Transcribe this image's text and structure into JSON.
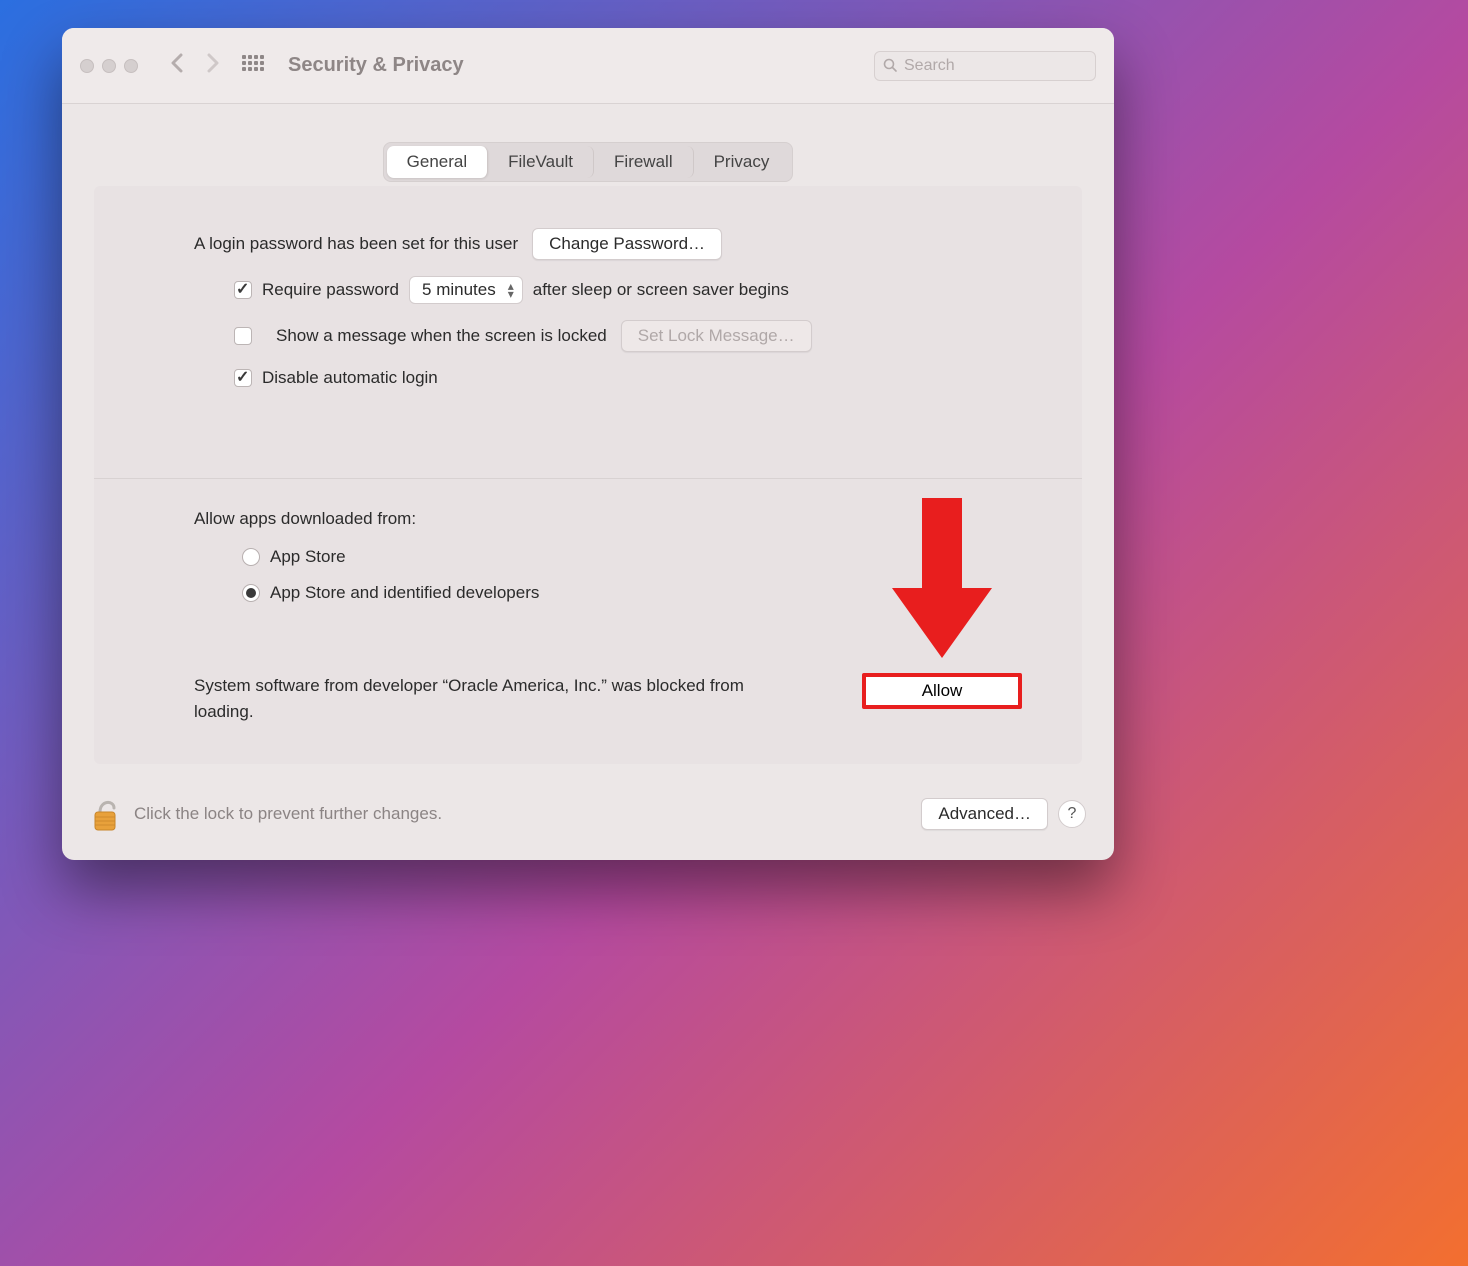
{
  "window": {
    "title": "Security & Privacy",
    "search_placeholder": "Search"
  },
  "tabs": [
    {
      "label": "General"
    },
    {
      "label": "FileVault"
    },
    {
      "label": "Firewall"
    },
    {
      "label": "Privacy"
    }
  ],
  "login": {
    "msg": "A login password has been set for this user",
    "change_btn": "Change Password…",
    "require_label": "Require password",
    "delay_value": "5 minutes",
    "after_label": "after sleep or screen saver begins",
    "show_msg_label": "Show a message when the screen is locked",
    "set_lock_btn": "Set Lock Message…",
    "disable_auto_label": "Disable automatic login"
  },
  "allow_apps": {
    "heading": "Allow apps downloaded from:",
    "options": [
      "App Store",
      "App Store and identified developers"
    ]
  },
  "blocked": {
    "text": "System software from developer “Oracle America, Inc.” was blocked from loading.",
    "allow_btn": "Allow"
  },
  "footer": {
    "lock_msg": "Click the lock to prevent further changes.",
    "advanced_btn": "Advanced…",
    "help": "?"
  },
  "annotation": {
    "arrow_color": "#e81e1e"
  }
}
